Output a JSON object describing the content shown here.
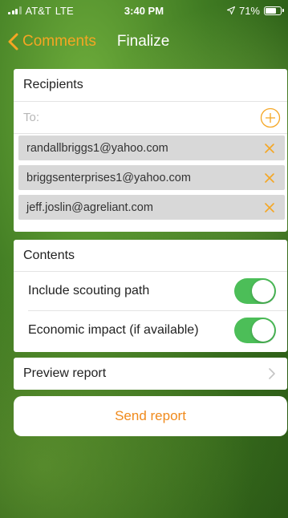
{
  "status_bar": {
    "carrier": "AT&T",
    "network": "LTE",
    "time": "3:40 PM",
    "battery_percent_label": "71%",
    "battery_level": 0.71
  },
  "nav": {
    "back_label": "Comments",
    "title": "Finalize"
  },
  "recipients": {
    "header": "Recipients",
    "to_placeholder": "To:",
    "emails": [
      "randallbriggs1@yahoo.com",
      "briggsenterprises1@yahoo.com",
      "jeff.joslin@agreliant.com"
    ]
  },
  "contents": {
    "header": "Contents",
    "options": [
      {
        "label": "Include scouting path",
        "enabled": true
      },
      {
        "label": "Economic impact (if available)",
        "enabled": true
      }
    ]
  },
  "preview": {
    "label": "Preview report"
  },
  "send": {
    "label": "Send report"
  },
  "colors": {
    "accent": "#f5a623",
    "send_text": "#f08a1c",
    "toggle_on": "#4cbe58",
    "chip_bg": "#d8d8d8"
  },
  "icons": {
    "back": "chevron-left-icon",
    "add": "plus-circle-icon",
    "remove": "close-icon",
    "preview": "chevron-right-icon",
    "location": "location-arrow-icon",
    "battery": "battery-icon",
    "signal": "signal-icon"
  }
}
